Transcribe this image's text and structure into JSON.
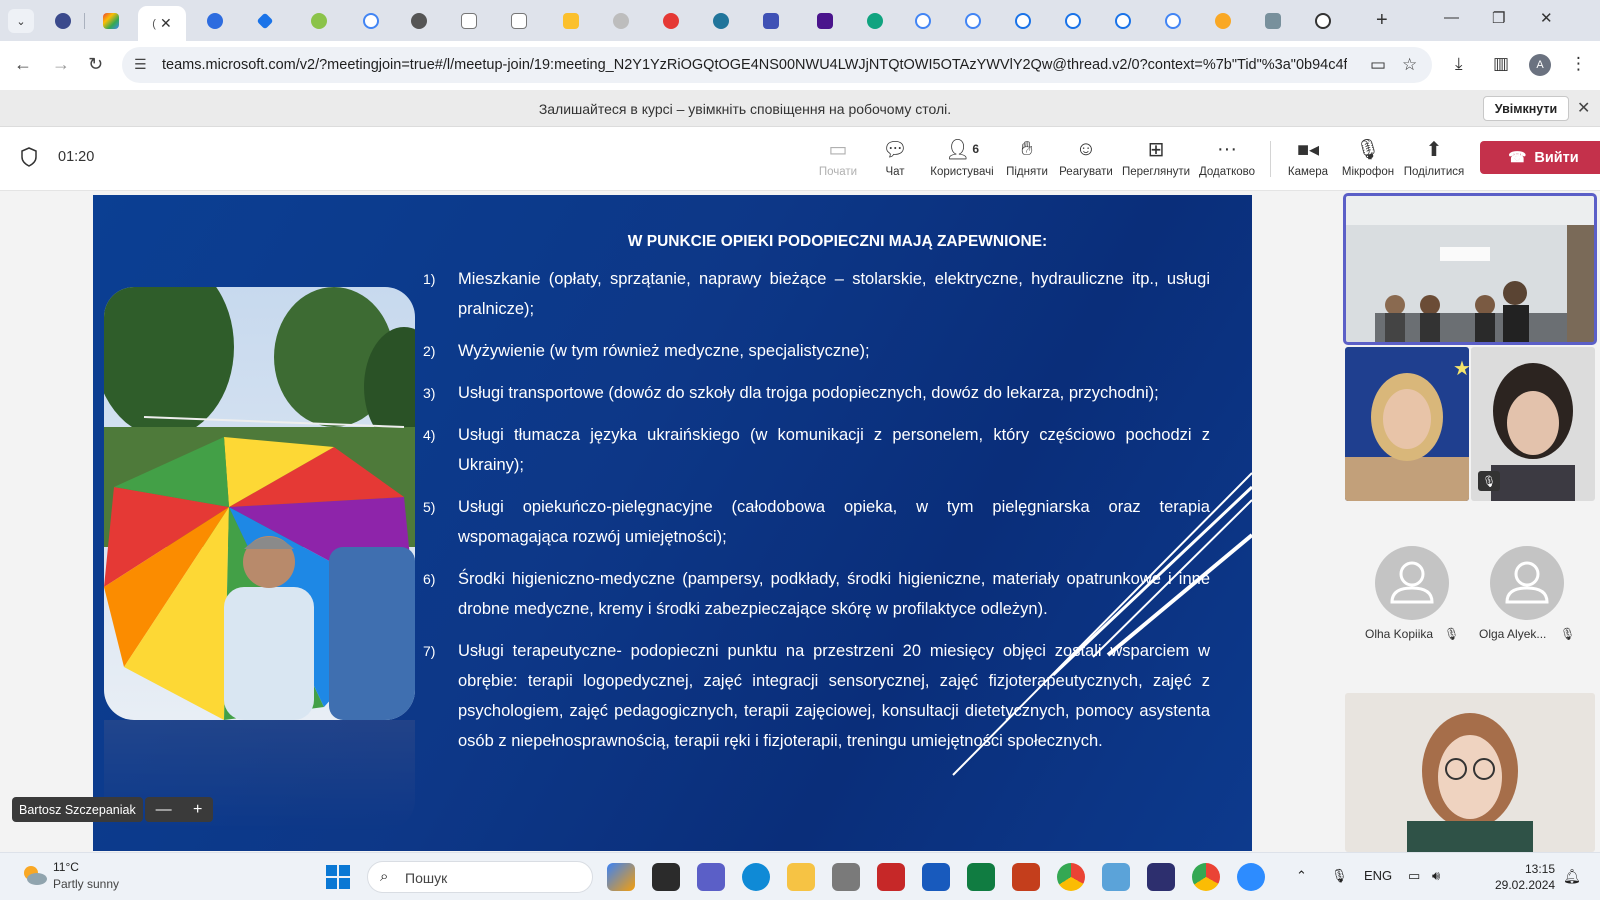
{
  "browser": {
    "active_tab_title": "(",
    "new_tab_label": "+",
    "url": "teams.microsoft.com/v2/?meetingjoin=true#/l/meetup-join/19:meeting_N2Y1YzRiOGQtOGE4NS00NWU4LWJjNTQtOWI5OTAzYWVlY2Qw@thread.v2/0?context=%7b\"Tid\"%3a\"0b94c4fb...",
    "profile_initial": "A"
  },
  "notification": {
    "text": "Залишайтеся в курсі – увімкніть сповіщення на робочому столі.",
    "button": "Увімкнути"
  },
  "meeting": {
    "timer": "01:20",
    "tools": {
      "start": "Почати",
      "chat": "Чат",
      "people": "Користувачі",
      "people_count": "6",
      "raise": "Підняти",
      "react": "Реагувати",
      "view": "Переглянути",
      "more": "Додатково",
      "camera": "Камера",
      "mic": "Мікрофон",
      "share": "Поділитися"
    },
    "leave": "Вийти"
  },
  "slide": {
    "title": "W PUNKCIE OPIEKI PODOPIECZNI MAJĄ ZAPEWNIONE:",
    "points": [
      {
        "num": "1)",
        "text": "Mieszkanie (opłaty, sprzątanie, naprawy bieżące – stolarskie, elektryczne, hydrauliczne itp., usługi pralnicze);"
      },
      {
        "num": "2)",
        "text": "Wyżywienie (w tym również medyczne, specjalistyczne);"
      },
      {
        "num": "3)",
        "text": "Usługi transportowe (dowóz do szkoły dla trojga podopiecznych, dowóz do lekarza, przychodni);"
      },
      {
        "num": "4)",
        "text": "Usługi tłumacza  języka ukraińskiego (w komunikacji z personelem, który częściowo pochodzi z Ukrainy);"
      },
      {
        "num": "5)",
        "text": "Usługi opiekuńczo-pielęgnacyjne (całodobowa opieka, w tym pielęgniarska oraz terapia wspomagająca rozwój umiejętności);"
      },
      {
        "num": "6)",
        "text": "Środki higieniczno-medyczne (pampersy, podkłady, środki higieniczne, materiały opatrunkowe i inne drobne medyczne, kremy i środki zabezpieczające skórę w profilaktyce odleżyn)."
      },
      {
        "num": "7)",
        "text": "Usługi terapeutyczne- podopieczni punktu na przestrzeni 20 miesięcy objęci zostali wsparciem w obrębie: terapii logopedycznej, zajęć integracji sensorycznej, zajęć fizjoterapeutycznych, zajęć z psychologiem, zajęć pedagogicznych, terapii zajęciowej, konsultacji dietetycznych, pomocy asystenta osób z niepełnosprawnością, terapii ręki i fizjoterapii, treningu umiejętności społecznych."
      }
    ]
  },
  "presenter": {
    "name": "Bartosz Szczepaniak",
    "zoom_out": "—",
    "zoom_in": "+"
  },
  "participants": [
    {
      "name": "Olha Kopiika"
    },
    {
      "name": "Olga Alyek..."
    }
  ],
  "taskbar": {
    "temperature": "11°C",
    "condition": "Partly sunny",
    "search_placeholder": "Пошук",
    "language": "ENG",
    "time": "13:15",
    "date": "29.02.2024"
  }
}
